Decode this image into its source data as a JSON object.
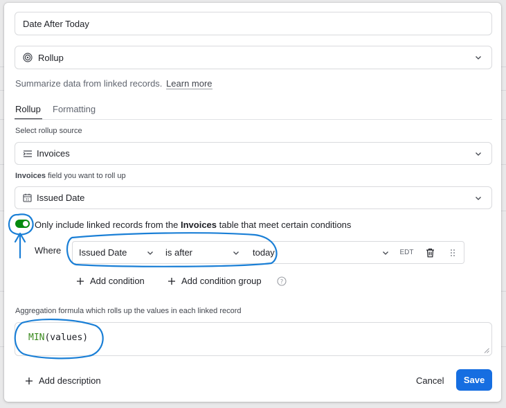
{
  "field_name": "Date After Today",
  "field_type": {
    "label": "Rollup",
    "icon": "rollup-icon"
  },
  "description": {
    "text": "Summarize data from linked records.",
    "link": "Learn more"
  },
  "tabs": [
    {
      "label": "Rollup",
      "active": true
    },
    {
      "label": "Formatting",
      "active": false
    }
  ],
  "rollup_source": {
    "label": "Select rollup source",
    "value": "Invoices",
    "icon": "linked-table-icon"
  },
  "rollup_field": {
    "label_bold": "Invoices",
    "label_rest": " field you want to roll up",
    "value": "Issued Date",
    "icon": "calendar-icon"
  },
  "conditions": {
    "toggle_on": true,
    "text_pre": "Only include linked records from the ",
    "text_bold": "Invoices",
    "text_post": " table that meet certain conditions",
    "where_label": "Where",
    "field": "Issued Date",
    "operator": "is after",
    "value": "today",
    "timezone_badge": "EDT",
    "add_condition": "Add condition",
    "add_group": "Add condition group"
  },
  "aggregation": {
    "label": "Aggregation formula which rolls up the values in each linked record",
    "func": "MIN",
    "args": "(values)"
  },
  "footer": {
    "add_description": "Add description",
    "cancel": "Cancel",
    "save": "Save"
  },
  "colors": {
    "accent": "#166ee1",
    "toggle": "#048a0e",
    "annotation": "#1a7fd6",
    "formula_func": "#3b8a1f"
  }
}
